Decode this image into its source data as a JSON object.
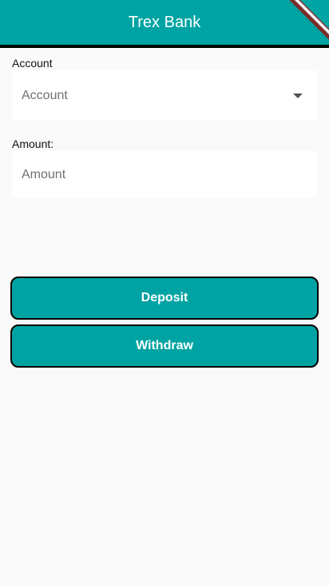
{
  "app_bar": {
    "title": "Trex Bank"
  },
  "account": {
    "label": "Account",
    "placeholder": "Account"
  },
  "amount": {
    "label": "Amount:",
    "placeholder": "Amount"
  },
  "actions": {
    "deposit_label": "Deposit",
    "withdraw_label": "Withdraw"
  },
  "colors": {
    "primary": "#00a3a3",
    "background": "#fafafa",
    "banner_stripe": "#7a2e2e"
  }
}
